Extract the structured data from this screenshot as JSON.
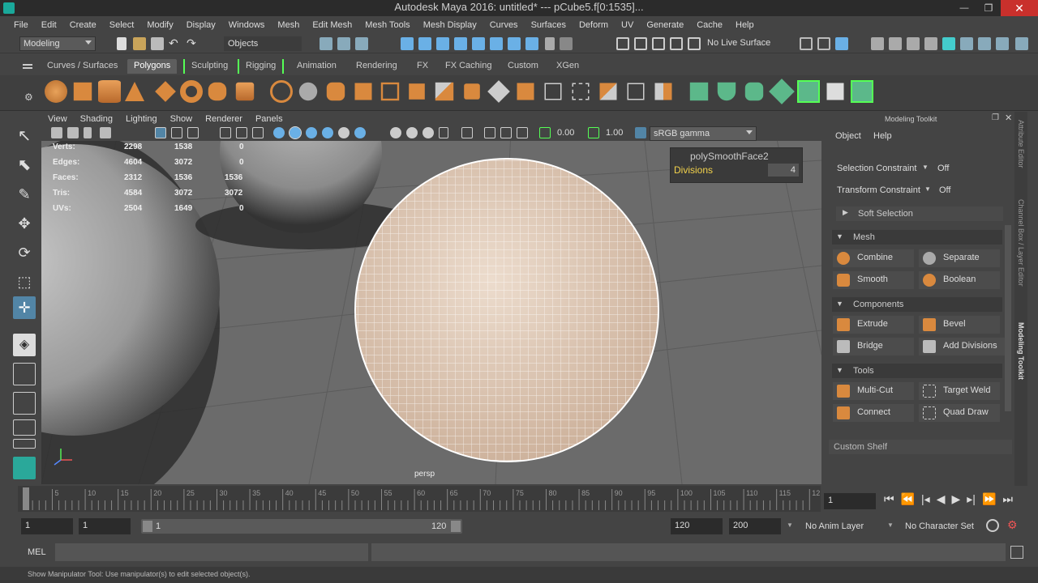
{
  "window": {
    "title": "Autodesk Maya 2016: untitled*   ---   pCube5.f[0:1535]..."
  },
  "menus": [
    "File",
    "Edit",
    "Create",
    "Select",
    "Modify",
    "Display",
    "Windows",
    "Mesh",
    "Edit Mesh",
    "Mesh Tools",
    "Mesh Display",
    "Curves",
    "Surfaces",
    "Deform",
    "UV",
    "Generate",
    "Cache",
    "Help"
  ],
  "status": {
    "mode": "Modeling",
    "objects": "Objects",
    "live_surface": "No Live Surface"
  },
  "shelf_tabs": [
    "Curves / Surfaces",
    "Polygons",
    "Sculpting",
    "Rigging",
    "Animation",
    "Rendering",
    "FX",
    "FX Caching",
    "Custom",
    "XGen"
  ],
  "panel_menus": [
    "View",
    "Shading",
    "Lighting",
    "Show",
    "Renderer",
    "Panels"
  ],
  "panel_toolbar": {
    "value1": "0.00",
    "value2": "1.00",
    "colorspace": "sRGB gamma"
  },
  "hud": {
    "rows": [
      {
        "label": "Verts:",
        "a": "2298",
        "b": "1538",
        "c": "0"
      },
      {
        "label": "Edges:",
        "a": "4604",
        "b": "3072",
        "c": "0"
      },
      {
        "label": "Faces:",
        "a": "2312",
        "b": "1536",
        "c": "1536"
      },
      {
        "label": "Tris:",
        "a": "4584",
        "b": "3072",
        "c": "3072"
      },
      {
        "label": "UVs:",
        "a": "2504",
        "b": "1649",
        "c": "0"
      }
    ]
  },
  "inview": {
    "node": "polySmoothFace2",
    "attr_label": "Divisions",
    "attr_value": "4"
  },
  "camera_label": "persp",
  "modeling_toolkit": {
    "title": "Modeling Toolkit",
    "menus": [
      "Object",
      "Help"
    ],
    "selection_constraint": "Selection Constraint",
    "selection_constraint_value": "Off",
    "transform_constraint": "Transform Constraint",
    "transform_constraint_value": "Off",
    "soft_selection": "Soft Selection",
    "sections": {
      "mesh": "Mesh",
      "components": "Components",
      "tools": "Tools"
    },
    "mesh_buttons": [
      "Combine",
      "Separate",
      "Smooth",
      "Boolean"
    ],
    "component_buttons": [
      "Extrude",
      "Bevel",
      "Bridge",
      "Add Divisions"
    ],
    "tool_buttons": [
      "Multi-Cut",
      "Target Weld",
      "Connect",
      "Quad Draw"
    ],
    "custom_shelf": "Custom Shelf"
  },
  "side_tabs": [
    "Attribute Editor",
    "Channel Box / Layer Editor",
    "Modeling Toolkit"
  ],
  "timeline": {
    "ticks": [
      "1",
      "5",
      "10",
      "15",
      "20",
      "25",
      "30",
      "35",
      "40",
      "45",
      "50",
      "55",
      "60",
      "65",
      "70",
      "75",
      "80",
      "85",
      "90",
      "95",
      "100",
      "105",
      "110",
      "115",
      "12"
    ],
    "current": "1"
  },
  "range": {
    "start": "1",
    "start2": "1",
    "slider_start": "1",
    "slider_end": "120",
    "end": "120",
    "end2": "200",
    "anim_layer": "No Anim Layer",
    "char_set": "No Character Set"
  },
  "mel_label": "MEL",
  "help_line": "Show Manipulator Tool: Use manipulator(s) to edit selected object(s)."
}
